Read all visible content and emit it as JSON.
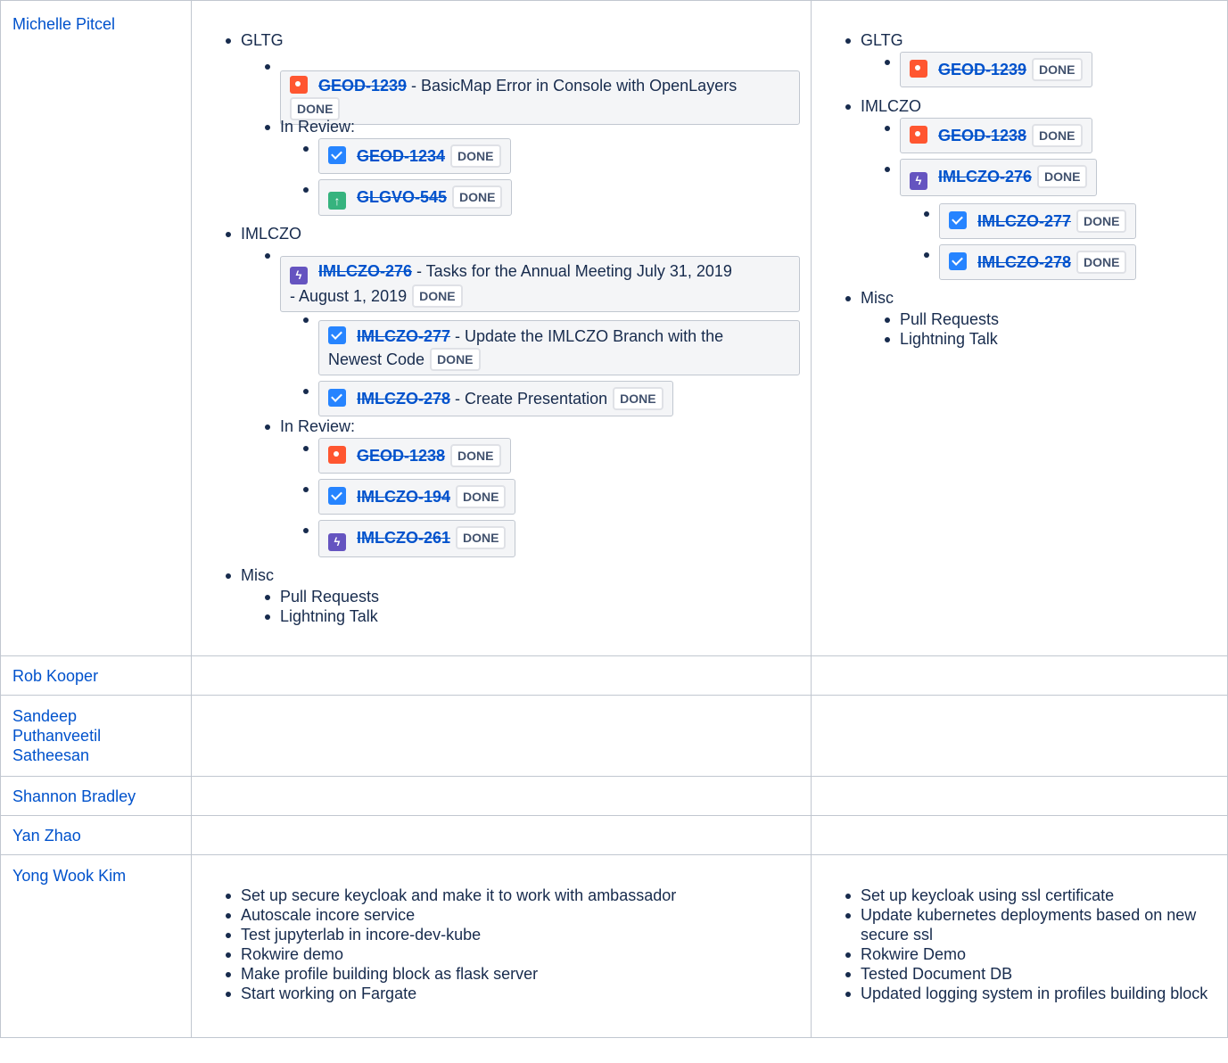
{
  "done": "DONE",
  "people": {
    "michelle": "Michelle Pitcel",
    "rob": "Rob Kooper",
    "sandeep_1": "Sandeep",
    "sandeep_2": "Puthanveetil",
    "sandeep_3": "Satheesan",
    "shannon": "Shannon Bradley",
    "yan": "Yan Zhao",
    "yong": "Yong Wook Kim"
  },
  "col2": {
    "gltg": "GLTG",
    "geod1239_key": "GEOD-1239",
    "geod1239_title": " - BasicMap Error in Console with OpenLayers",
    "in_review": "In Review:",
    "geod1234_key": "GEOD-1234",
    "glgvo545_key": "GLGVO-545",
    "imlczo": "IMLCZO",
    "imlczo276_key": "IMLCZO-276",
    "imlczo276_title_a": " - Tasks for the Annual Meeting July 31, 2019",
    "imlczo276_title_b": "- August 1, 2019",
    "imlczo277_key": "IMLCZO-277",
    "imlczo277_title_a": " - Update the IMLCZO Branch with the",
    "imlczo277_title_b": "Newest Code",
    "imlczo278_key": "IMLCZO-278",
    "imlczo278_title": " - Create Presentation",
    "geod1238_key": "GEOD-1238",
    "imlczo194_key": "IMLCZO-194",
    "imlczo261_key": "IMLCZO-261",
    "misc": "Misc",
    "pull_requests": "Pull Requests",
    "lightning_talk": "Lightning Talk"
  },
  "col3": {
    "gltg": "GLTG",
    "geod1239_key": "GEOD-1239",
    "imlczo": "IMLCZO",
    "geod1238_key": "GEOD-1238",
    "imlczo276_key": "IMLCZO-276",
    "imlczo277_key": "IMLCZO-277",
    "imlczo278_key": "IMLCZO-278",
    "misc": "Misc",
    "pull_requests": "Pull Requests",
    "lightning_talk": "Lightning Talk"
  },
  "yong_planned": [
    "Set up secure keycloak and make it to work with ambassador",
    "Autoscale incore service",
    "Test jupyterlab in incore-dev-kube",
    "Rokwire demo",
    "Make profile building block as flask server",
    "Start working on Fargate"
  ],
  "yong_done": [
    "Set up keycloak using ssl certificate",
    "Update kubernetes deployments based on new secure ssl",
    "Rokwire Demo",
    "Tested Document DB",
    "Updated logging system in profiles building block"
  ]
}
